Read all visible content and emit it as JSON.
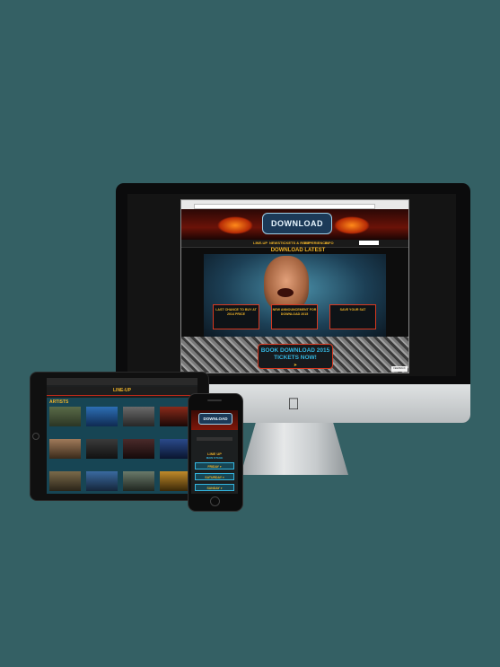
{
  "colors": {
    "background": "#346064",
    "accent_yellow": "#f0b429",
    "accent_blue": "#34b6e0",
    "accent_red": "#d9381f"
  },
  "desktop": {
    "logo_text": "DOWNLOAD",
    "nav": [
      "LINE-UP",
      "NEWS",
      "TICKETS & RSVP",
      "EXPERIENCE",
      "INFO"
    ],
    "section_title": "DOWNLOAD LATEST",
    "cards": [
      {
        "title": "LAST CHANCE TO BUY AT 2014 PRICE",
        "sub": ""
      },
      {
        "title": "NEW ANNOUNCEMENT FOR DOWNLOAD 2015",
        "sub": ""
      },
      {
        "title": "SAVE YOUR SAT",
        "sub": ""
      }
    ],
    "book_line1": "BOOK DOWNLOAD 2015",
    "book_line2": "TICKETS NOW!",
    "feedback": "FEEDBACK",
    "apple_icon": "apple-logo-icon"
  },
  "tablet": {
    "header": "LINE-UP",
    "section": "ARTISTS",
    "artists": [
      "",
      "",
      "",
      "",
      "",
      "",
      "",
      "",
      "",
      "",
      "",
      ""
    ]
  },
  "phone": {
    "logo_text": "DOWNLOAD",
    "line_up": "LINE UP",
    "stage": "MAIN STAGE",
    "days": [
      "FRIDAY ▾",
      "SATURDAY ▾",
      "SUNDAY ▾"
    ]
  }
}
